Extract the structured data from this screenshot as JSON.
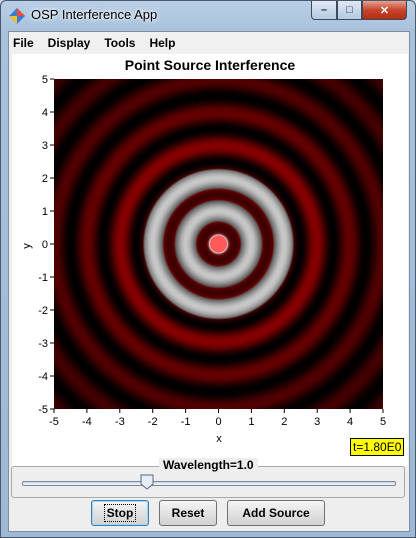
{
  "window": {
    "title": "OSP Interference App",
    "controls": {
      "minimize": "–",
      "maximize": "□",
      "close": "✕"
    }
  },
  "menu": {
    "items": [
      "File",
      "Display",
      "Tools",
      "Help"
    ]
  },
  "plot": {
    "title": "Point Source Interference",
    "x_label": "x",
    "y_label": "y",
    "x_ticks": [
      "-5",
      "-4",
      "-3",
      "-2",
      "-1",
      "0",
      "1",
      "2",
      "3",
      "4",
      "5"
    ],
    "y_ticks": [
      "5",
      "4",
      "3",
      "2",
      "1",
      "0",
      "-1",
      "-2",
      "-3",
      "-4",
      "-5"
    ],
    "x_range": [
      -5,
      5
    ],
    "y_range": [
      -5,
      5
    ],
    "source_position": [
      0,
      0
    ],
    "wavelength": 1.0,
    "colors": {
      "wave": "#e00000",
      "saturated": "#c8c8c8",
      "background": "#000000"
    }
  },
  "time_readout": "t=1.80E0",
  "controls": {
    "slider_label": "Wavelength=1.0",
    "slider_value": 1.0
  },
  "buttons": {
    "stop": "Stop",
    "reset": "Reset",
    "add_source": "Add Source"
  }
}
